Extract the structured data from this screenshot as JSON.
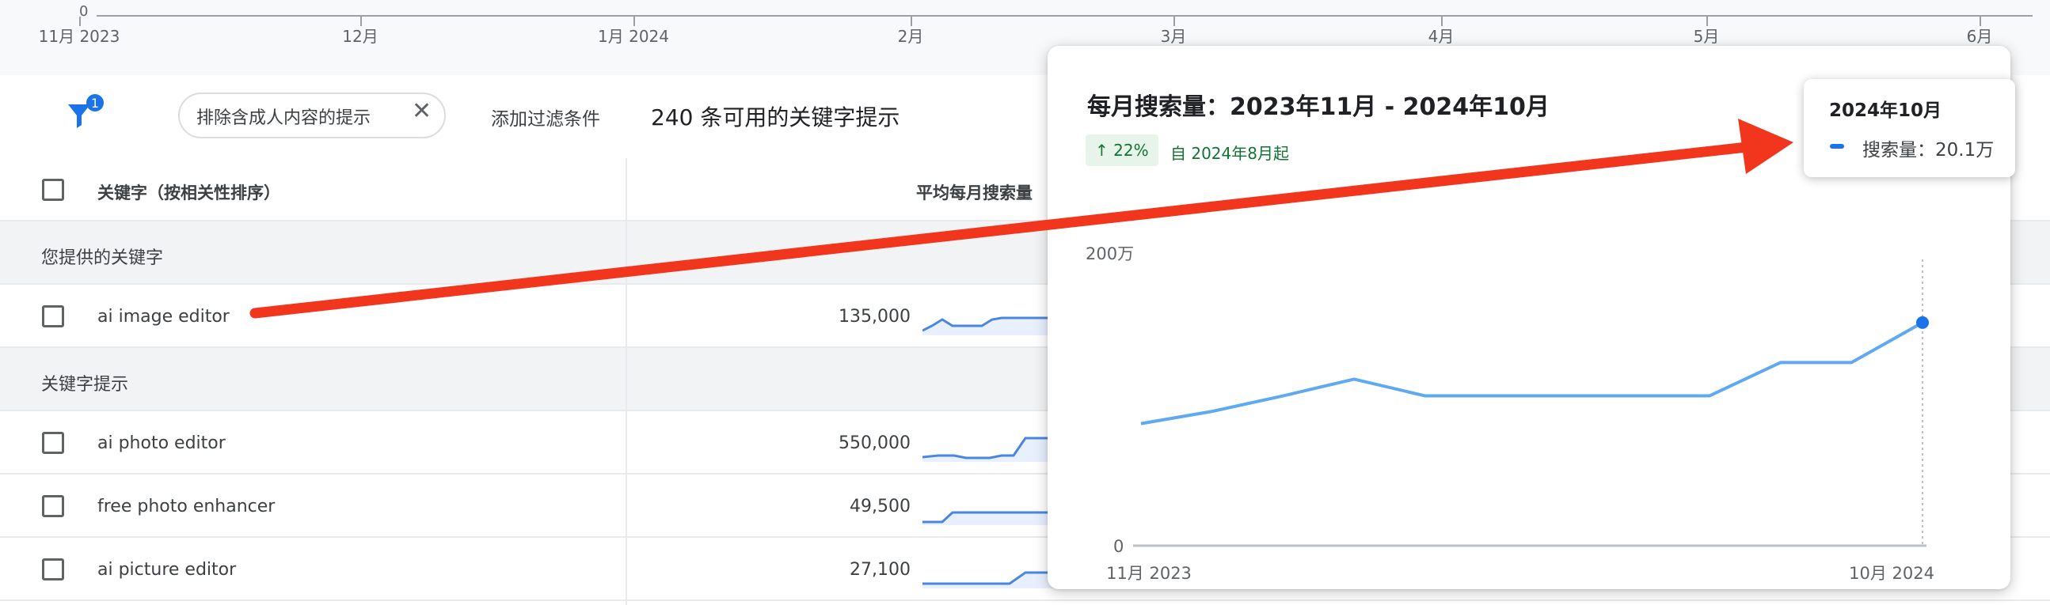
{
  "timeline": {
    "zero_label": "0",
    "ticks": [
      "11月 2023",
      "12月",
      "1月 2024",
      "2月",
      "3月",
      "4月",
      "5月",
      "6月"
    ]
  },
  "filter_bar": {
    "filter_badge_count": "1",
    "chip_label": "排除含成人内容的提示",
    "chip_close": "✕",
    "add_filter": "添加过滤条件",
    "available_count": "240 条可用的关键字提示"
  },
  "table": {
    "header_keyword": "关键字（按相关性排序）",
    "header_avg_search": "平均每月搜索量",
    "group_provided": "您提供的关键字",
    "group_suggestions": "关键字提示",
    "provided_rows": [
      {
        "keyword": "ai image editor",
        "volume": "135,000"
      }
    ],
    "suggestion_rows": [
      {
        "keyword": "ai photo editor",
        "volume": "550,000"
      },
      {
        "keyword": "free photo enhancer",
        "volume": "49,500"
      },
      {
        "keyword": "ai picture editor",
        "volume": "27,100"
      }
    ]
  },
  "popup": {
    "title": "每月搜索量：2023年11月 - 2024年10月",
    "trend_badge": "↑ 22%",
    "trend_since": "自 2024年8月起",
    "chart_label_top": "200万",
    "chart_y_zero": "0",
    "x_start_label": "11月 2023",
    "x_end_label": "10月 2024"
  },
  "tooltip": {
    "date": "2024年10月",
    "value_text": "搜索量：20.1万"
  },
  "colors": {
    "line": "#5ea9f0",
    "spark": "#4a86e0",
    "trend_green": "#137333",
    "arrow": "#f2361d"
  },
  "chart_data": {
    "type": "line",
    "title": "每月搜索量：2023年11月 - 2024年10月",
    "x": [
      "2023-11",
      "2023-12",
      "2024-01",
      "2024-02",
      "2024-03",
      "2024-04",
      "2024-05",
      "2024-06",
      "2024-07",
      "2024-08",
      "2024-09",
      "2024-10"
    ],
    "series": [
      {
        "name": "搜索量",
        "values": [
          110000,
          121000,
          135000,
          150000,
          135000,
          135000,
          135000,
          135000,
          135000,
          165000,
          165000,
          201000
        ]
      }
    ],
    "ylim": [
      0,
      285000
    ],
    "xlabel": "",
    "ylabel": ""
  }
}
